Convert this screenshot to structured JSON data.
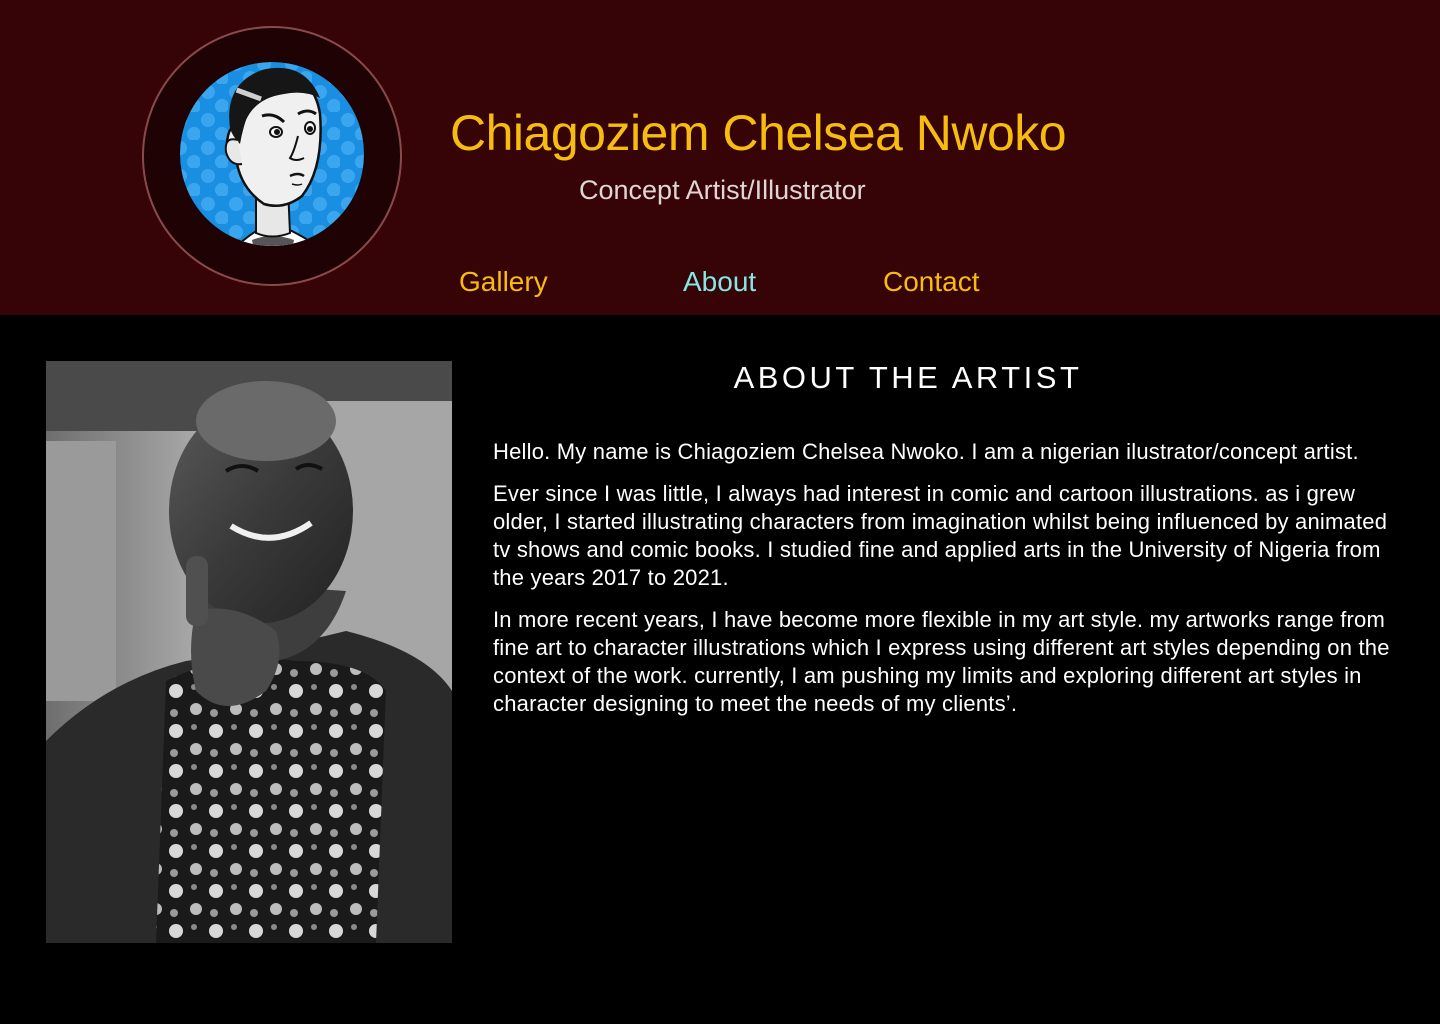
{
  "header": {
    "name": "Chiagoziem Chelsea Nwoko",
    "subtitle": "Concept Artist/Illustrator",
    "avatar_icon": "cartoon-avatar-portrait"
  },
  "nav": {
    "items": [
      {
        "label": "Gallery",
        "active": false
      },
      {
        "label": "About",
        "active": true
      },
      {
        "label": "Contact",
        "active": false
      }
    ]
  },
  "about": {
    "heading": "ABOUT THE ARTIST",
    "paragraphs": [
      "Hello. My name is Chiagoziem Chelsea Nwoko. I am a nigerian ilustrator/concept artist.",
      "Ever since I was little, I always had interest in comic and cartoon illustrations. as i grew older, I started illustrating characters from imagination whilst being influenced by animated tv shows and comic books. I studied fine and applied arts in the University of Nigeria from the years 2017 to 2021.",
      "In more recent years, I have become more flexible in my art style. my artworks range from fine art to character illustrations which I express using different art styles depending on the context of the work. currently, I am pushing my limits and exploring different art styles in character designing to meet the needs of my clients’."
    ]
  },
  "colors": {
    "header_bg": "#360306",
    "page_bg": "#000000",
    "title": "#f7bd0e",
    "nav_link": "#f7bd0e",
    "nav_active": "#86e6e3",
    "avatar_bg": "#1a8ee0"
  }
}
